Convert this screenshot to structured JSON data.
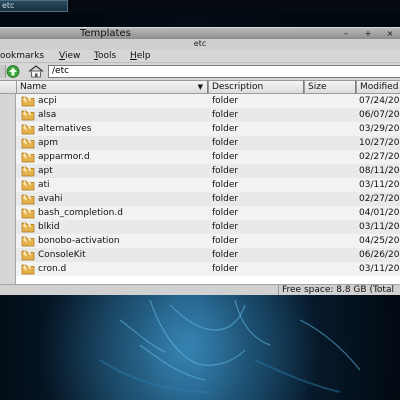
{
  "colors": {
    "folder_icon": "#e6b04a",
    "desktop_accent": "#1f5f8a"
  },
  "taskbar": {
    "task_label": "etc"
  },
  "background_window": {
    "title": "Templates",
    "controls": [
      "–",
      "+",
      "×"
    ]
  },
  "file_manager": {
    "title": "etc",
    "menu": [
      "ookmarks",
      "View",
      "Tools",
      "Help"
    ],
    "location": "/etc",
    "columns": [
      "Name",
      "Description",
      "Size",
      "Modified"
    ],
    "files": [
      {
        "name": "acpi",
        "description": "folder",
        "size": "",
        "modified": "07/24/20",
        "icon": "folder-icon"
      },
      {
        "name": "alsa",
        "description": "folder",
        "size": "",
        "modified": "06/07/20",
        "icon": "folder-icon"
      },
      {
        "name": "alternatives",
        "description": "folder",
        "size": "",
        "modified": "03/29/20",
        "icon": "folder-icon"
      },
      {
        "name": "apm",
        "description": "folder",
        "size": "",
        "modified": "10/27/20",
        "icon": "folder-icon"
      },
      {
        "name": "apparmor.d",
        "description": "folder",
        "size": "",
        "modified": "02/27/20",
        "icon": "folder-icon"
      },
      {
        "name": "apt",
        "description": "folder",
        "size": "",
        "modified": "08/11/20",
        "icon": "folder-icon"
      },
      {
        "name": "ati",
        "description": "folder",
        "size": "",
        "modified": "03/11/20",
        "icon": "folder-icon"
      },
      {
        "name": "avahi",
        "description": "folder",
        "size": "",
        "modified": "02/27/20",
        "icon": "folder-icon"
      },
      {
        "name": "bash_completion.d",
        "description": "folder",
        "size": "",
        "modified": "04/01/20",
        "icon": "folder-icon"
      },
      {
        "name": "blkid",
        "description": "folder",
        "size": "",
        "modified": "03/11/20",
        "icon": "folder-icon"
      },
      {
        "name": "bonobo-activation",
        "description": "folder",
        "size": "",
        "modified": "04/25/20",
        "icon": "folder-icon"
      },
      {
        "name": "ConsoleKit",
        "description": "folder",
        "size": "",
        "modified": "06/26/20",
        "icon": "folder-icon"
      },
      {
        "name": "cron.d",
        "description": "folder",
        "size": "",
        "modified": "03/11/20",
        "icon": "folder-icon"
      }
    ],
    "status": {
      "free_space": "Free space: 8.8 GB (Total"
    }
  }
}
